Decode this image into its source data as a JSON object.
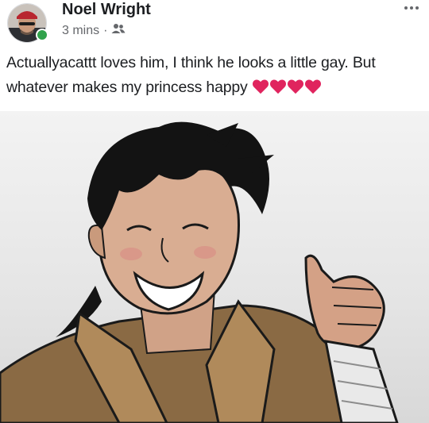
{
  "post": {
    "author": "Noel Wright",
    "time": "3 mins",
    "separator": "·",
    "audience_icon": "friends-icon",
    "menu_icon": "more-options-icon",
    "text": "Actuallyacattt loves him, I think he looks a little gay. But whatever makes my princess happy",
    "reaction_emoji": [
      "red-heart",
      "red-heart",
      "red-heart",
      "red-heart"
    ],
    "online_status": "online"
  },
  "colors": {
    "author_text": "#1c1e21",
    "meta_text": "#65676b",
    "online": "#31a24c",
    "heart": "#e0245e"
  }
}
